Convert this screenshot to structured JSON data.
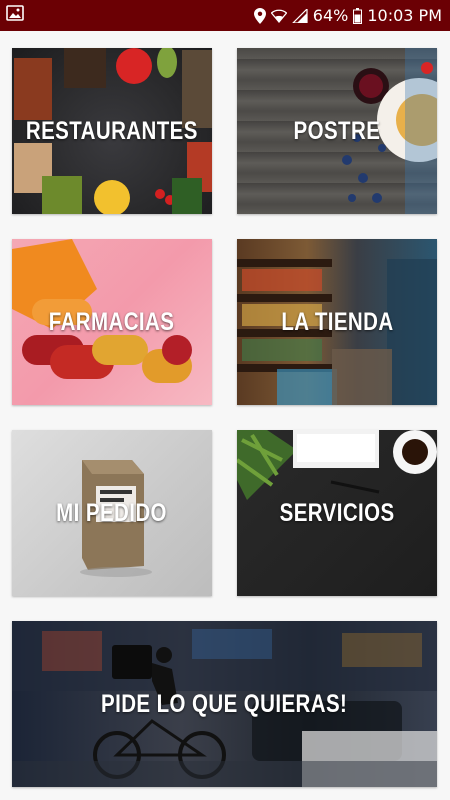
{
  "status_bar": {
    "battery": "64%",
    "time": "10:03 PM",
    "icons": [
      "gallery-icon",
      "location-icon",
      "wifi-icon",
      "signal-icon",
      "battery-icon"
    ]
  },
  "tiles": {
    "restaurantes": "RESTAURANTES",
    "postre": "POSTRE",
    "farmacias": "FARMACIAS",
    "la_tienda": "LA TIENDA",
    "mi_pedido": "MI PEDIDO",
    "servicios": "SERVICIOS",
    "pide": "PIDE LO QUE QUIERAS!"
  },
  "colors": {
    "status_bar": "#6b0004",
    "label": "#ffffff"
  }
}
